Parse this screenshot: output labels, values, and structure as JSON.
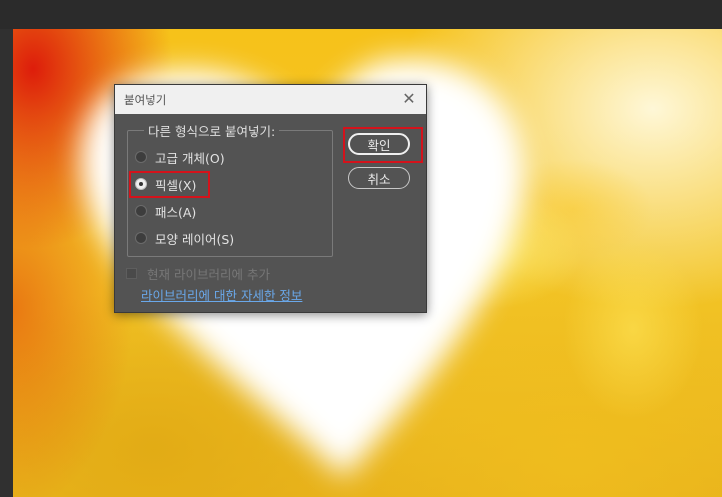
{
  "dialog": {
    "title": "붙여넣기",
    "close_glyph": "✕",
    "group_label": "다른 형식으로 붙여넣기:",
    "options": [
      {
        "label": "고급 개체(O)",
        "selected": false
      },
      {
        "label": "픽셀(X)",
        "selected": true
      },
      {
        "label": "패스(A)",
        "selected": false
      },
      {
        "label": "모양 레이어(S)",
        "selected": false
      }
    ],
    "ok_label": "확인",
    "cancel_label": "취소",
    "add_to_library_label": "현재 라이브러리에 추가",
    "add_to_library_checked": false,
    "add_to_library_enabled": false,
    "learn_more_link": "라이브러리에 대한 자세한 정보"
  },
  "colors": {
    "highlight": "#d4121b",
    "dialog_bg": "#535353",
    "link": "#6aa8ea",
    "canvas_yellow": "#f6c21a",
    "canvas_red": "#dc140a"
  }
}
